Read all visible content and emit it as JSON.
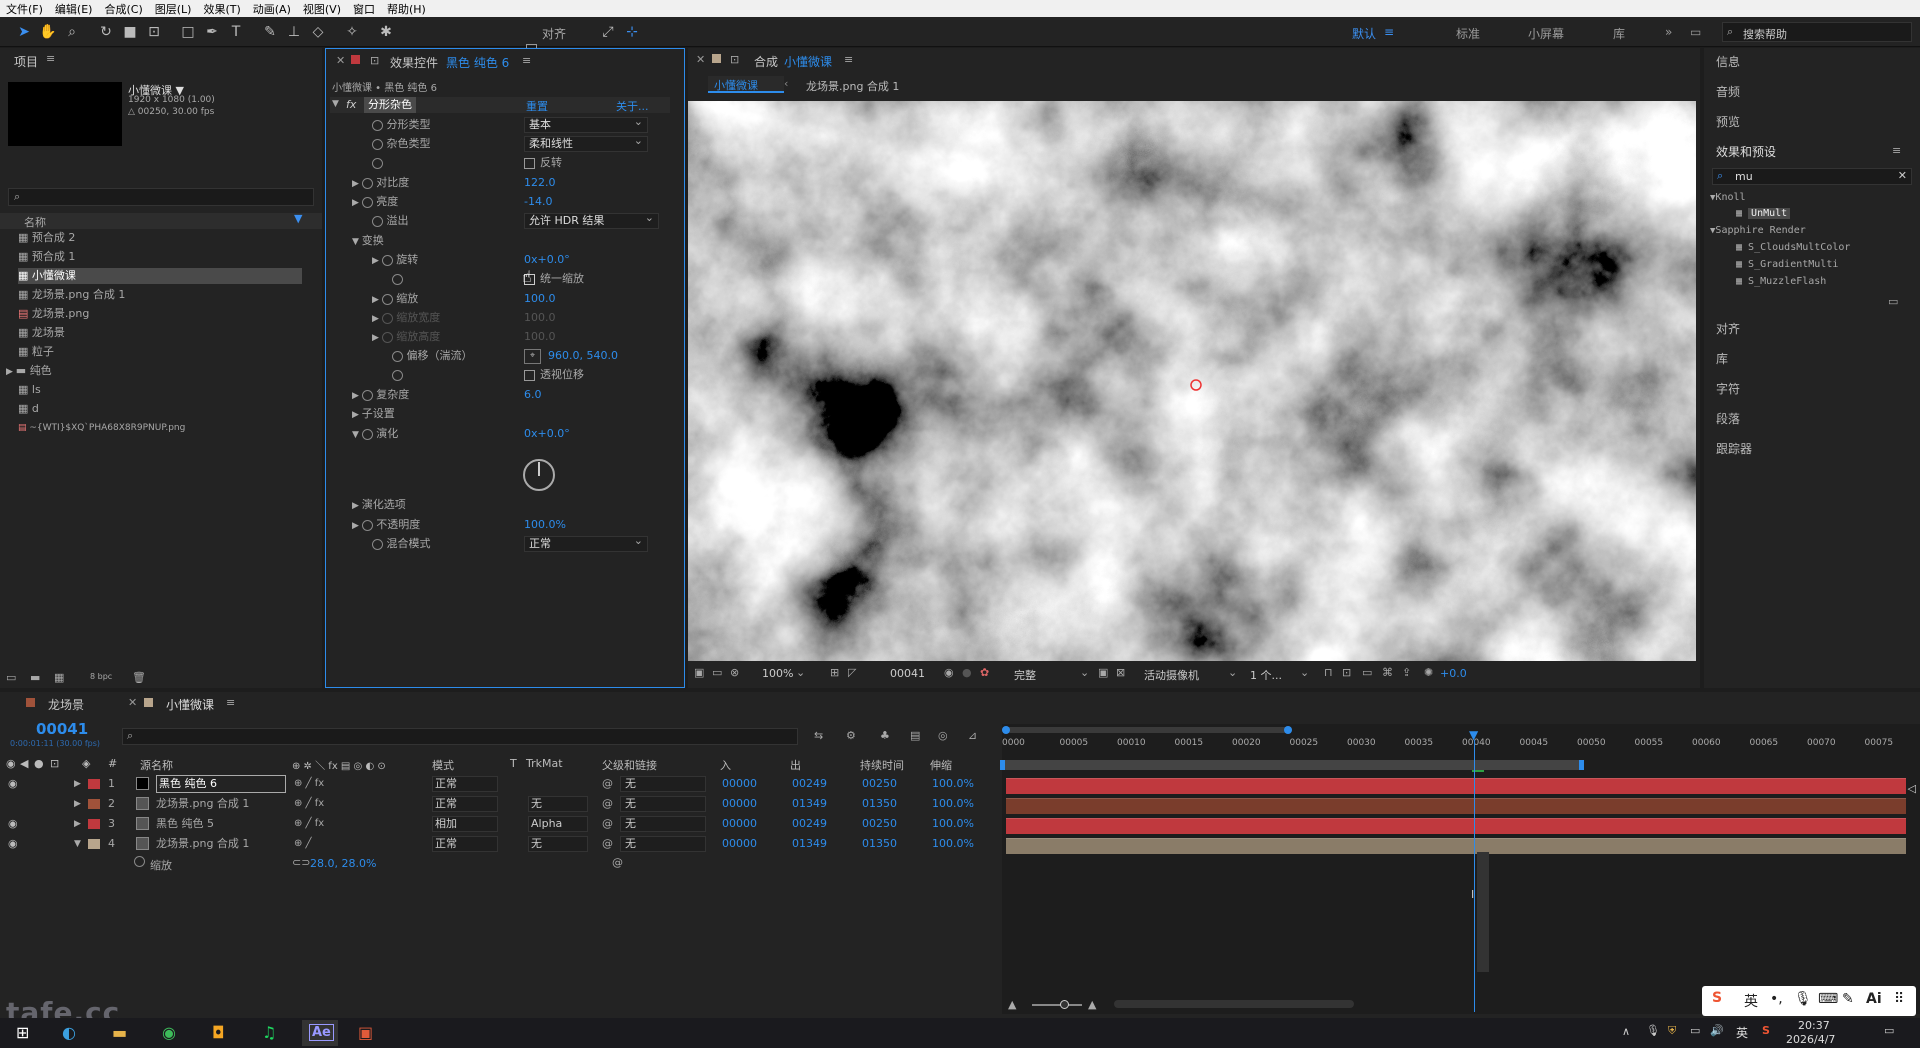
{
  "menu": [
    "文件(F)",
    "编辑(E)",
    "合成(C)",
    "图层(L)",
    "效果(T)",
    "动画(A)",
    "视图(V)",
    "窗口",
    "帮助(H)"
  ],
  "toolbar": {
    "snap_label": "对齐",
    "workspaces": [
      "默认",
      "标准",
      "小屏幕",
      "库"
    ],
    "search_placeholder": "搜索帮助"
  },
  "project": {
    "title": "项目",
    "comp_name": "小懂微课 ▼",
    "comp_res": "1920 x 1080 (1.00)",
    "comp_dur": "△ 00250, 30.00 fps",
    "col_name": "名称",
    "items": [
      "预合成 2",
      "预合成 1",
      "小懂微课",
      "龙场景.png 合成 1",
      "龙场景.png",
      "龙场景",
      "粒子",
      "纯色",
      "ls",
      "d",
      "~{WTI}$XQ`PHA68X8R9PNUP.png"
    ],
    "bpc": "8 bpc"
  },
  "effect": {
    "title": "效果控件",
    "layer": "黑色 纯色 6",
    "breadcrumb": "小懂微课 • 黑色 纯色 6",
    "fx_name": "分形杂色",
    "reset": "重置",
    "about": "关于...",
    "props": {
      "fractal_type": "分形类型",
      "fractal_val": "基本",
      "noise_type": "杂色类型",
      "noise_val": "柔和线性",
      "invert": "反转",
      "contrast": "对比度",
      "contrast_val": "122.0",
      "brightness": "亮度",
      "brightness_val": "-14.0",
      "overflow": "溢出",
      "overflow_val": "允许 HDR 结果",
      "transform": "变换",
      "rotation": "旋转",
      "rotation_val": "0x+0.0°",
      "uniform": "统一缩放",
      "scale": "缩放",
      "scale_val": "100.0",
      "scale_w": "缩放宽度",
      "scale_w_val": "100.0",
      "scale_h": "缩放高度",
      "scale_h_val": "100.0",
      "offset": "偏移（湍流）",
      "offset_val": "960.0, 540.0",
      "perspective": "透视位移",
      "complexity": "复杂度",
      "complexity_val": "6.0",
      "sub": "子设置",
      "evolution": "演化",
      "evolution_val": "0x+0.0°",
      "evo_opts": "演化选项",
      "opacity": "不透明度",
      "opacity_val": "100.0%",
      "blend": "混合模式",
      "blend_val": "正常"
    }
  },
  "comp": {
    "title": "合成",
    "name": "小懂微课",
    "tab": "小懂微课",
    "crumb": "龙场景.png 合成 1",
    "zoom": "100%",
    "frame": "00041",
    "quality": "完整",
    "camera": "活动摄像机",
    "view": "1 个...",
    "exposure": "+0.0"
  },
  "right": {
    "items_top": [
      "信息",
      "音频",
      "预览"
    ],
    "effects_title": "效果和预设",
    "search_val": "mu",
    "tree": [
      {
        "name": "Knoll",
        "children": [
          "UnMult"
        ]
      },
      {
        "name": "Sapphire Render",
        "children": [
          "S_CloudsMultColor",
          "S_GradientMulti",
          "S_MuzzleFlash"
        ]
      }
    ],
    "items_bottom": [
      "对齐",
      "库",
      "字符",
      "段落",
      "跟踪器"
    ]
  },
  "timeline": {
    "tabs": [
      "龙场景",
      "小懂微课"
    ],
    "timecode": "00041",
    "tc_sub": "0:00:01:11 (30.00 fps)",
    "cols": {
      "src": "源名称",
      "mode": "模式",
      "t": "T",
      "trk": "TrkMat",
      "parent": "父级和链接",
      "in": "入",
      "out": "出",
      "dur": "持续时间",
      "stretch": "伸缩"
    },
    "ruler": [
      "0000",
      "00005",
      "00010",
      "00015",
      "00020",
      "00025",
      "00030",
      "00035",
      "00040",
      "00045",
      "00050",
      "00055",
      "00060",
      "00065",
      "00070",
      "00075"
    ],
    "layers": [
      {
        "num": "1",
        "name": "黑色 纯色 6",
        "mode": "正常",
        "trk": "",
        "parent": "无",
        "in": "00000",
        "out": "00249",
        "dur": "00250",
        "str": "100.0%",
        "color": "#c0393e"
      },
      {
        "num": "2",
        "name": "龙场景.png 合成 1",
        "mode": "正常",
        "trk": "无",
        "parent": "无",
        "in": "00000",
        "out": "01349",
        "dur": "01350",
        "str": "100.0%",
        "color": "#a0523a"
      },
      {
        "num": "3",
        "name": "黑色 纯色 5",
        "mode": "相加",
        "trk": "Alpha",
        "parent": "无",
        "in": "00000",
        "out": "00249",
        "dur": "00250",
        "str": "100.0%",
        "color": "#c0393e"
      },
      {
        "num": "4",
        "name": "龙场景.png 合成 1",
        "mode": "正常",
        "trk": "无",
        "parent": "无",
        "in": "00000",
        "out": "01349",
        "dur": "01350",
        "str": "100.0%",
        "color": "#b8a58c"
      }
    ],
    "sub_prop": "缩放",
    "sub_val": "28.0, 28.0%"
  },
  "taskbar": {
    "ime": "英",
    "time": "20:37",
    "date": "2026/4/7",
    "ime2": "英"
  },
  "watermark": "tafe.cc"
}
